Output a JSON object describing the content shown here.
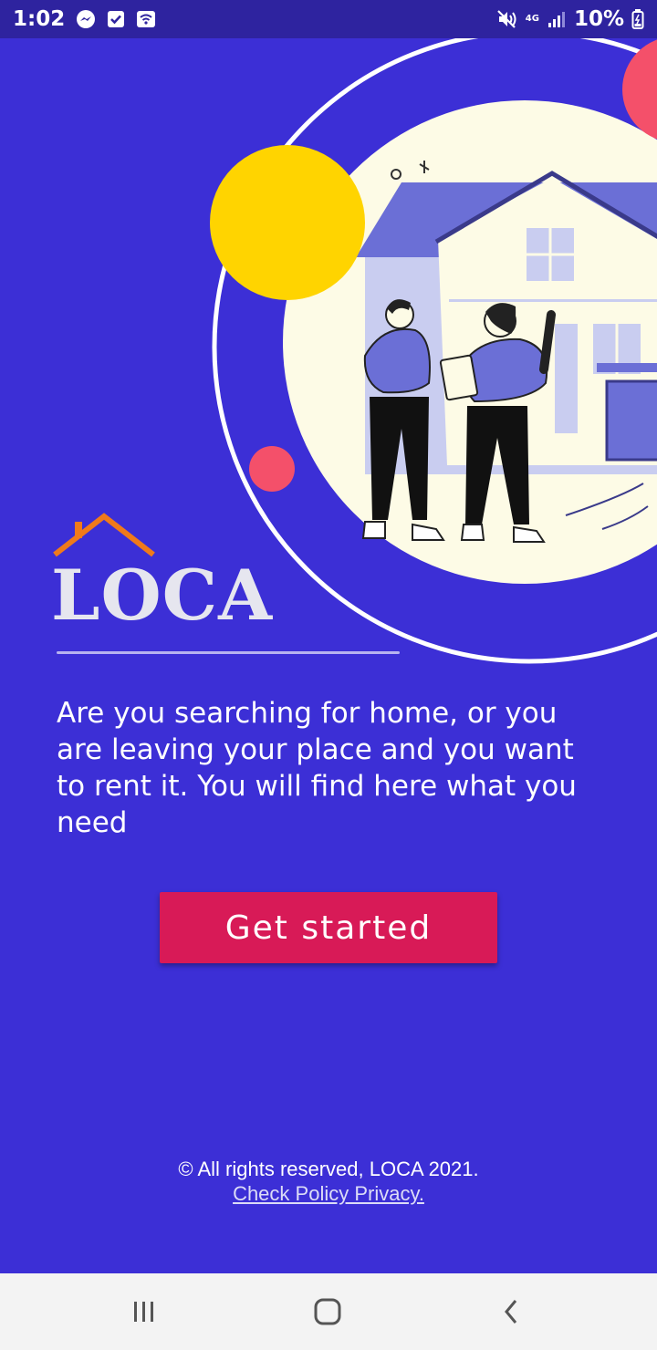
{
  "status_bar": {
    "time": "1:02",
    "network": "4G",
    "battery": "10%"
  },
  "logo": {
    "text": "LOCA",
    "roof_color": "#f07a1a"
  },
  "tagline": "Are you searching for home, or you are leaving your place and you want to rent it. You will find here what you need",
  "cta": {
    "label": "Get started"
  },
  "footer": {
    "copyright": "© All rights reserved, LOCA 2021.",
    "policy_link": "Check Policy Privacy."
  },
  "colors": {
    "background": "#3c2fd6",
    "status_bar": "#2e239f",
    "cta": "#d81a57",
    "accent_yellow": "#ffd400",
    "accent_pink": "#f4506a"
  },
  "icons": {
    "status_left": [
      "messenger-icon",
      "checkbox-icon",
      "wifi-icon"
    ],
    "status_right": [
      "mute-icon",
      "network-4g-icon",
      "signal-icon",
      "battery-icon"
    ],
    "nav": [
      "recent-apps-icon",
      "home-icon",
      "back-icon"
    ]
  }
}
